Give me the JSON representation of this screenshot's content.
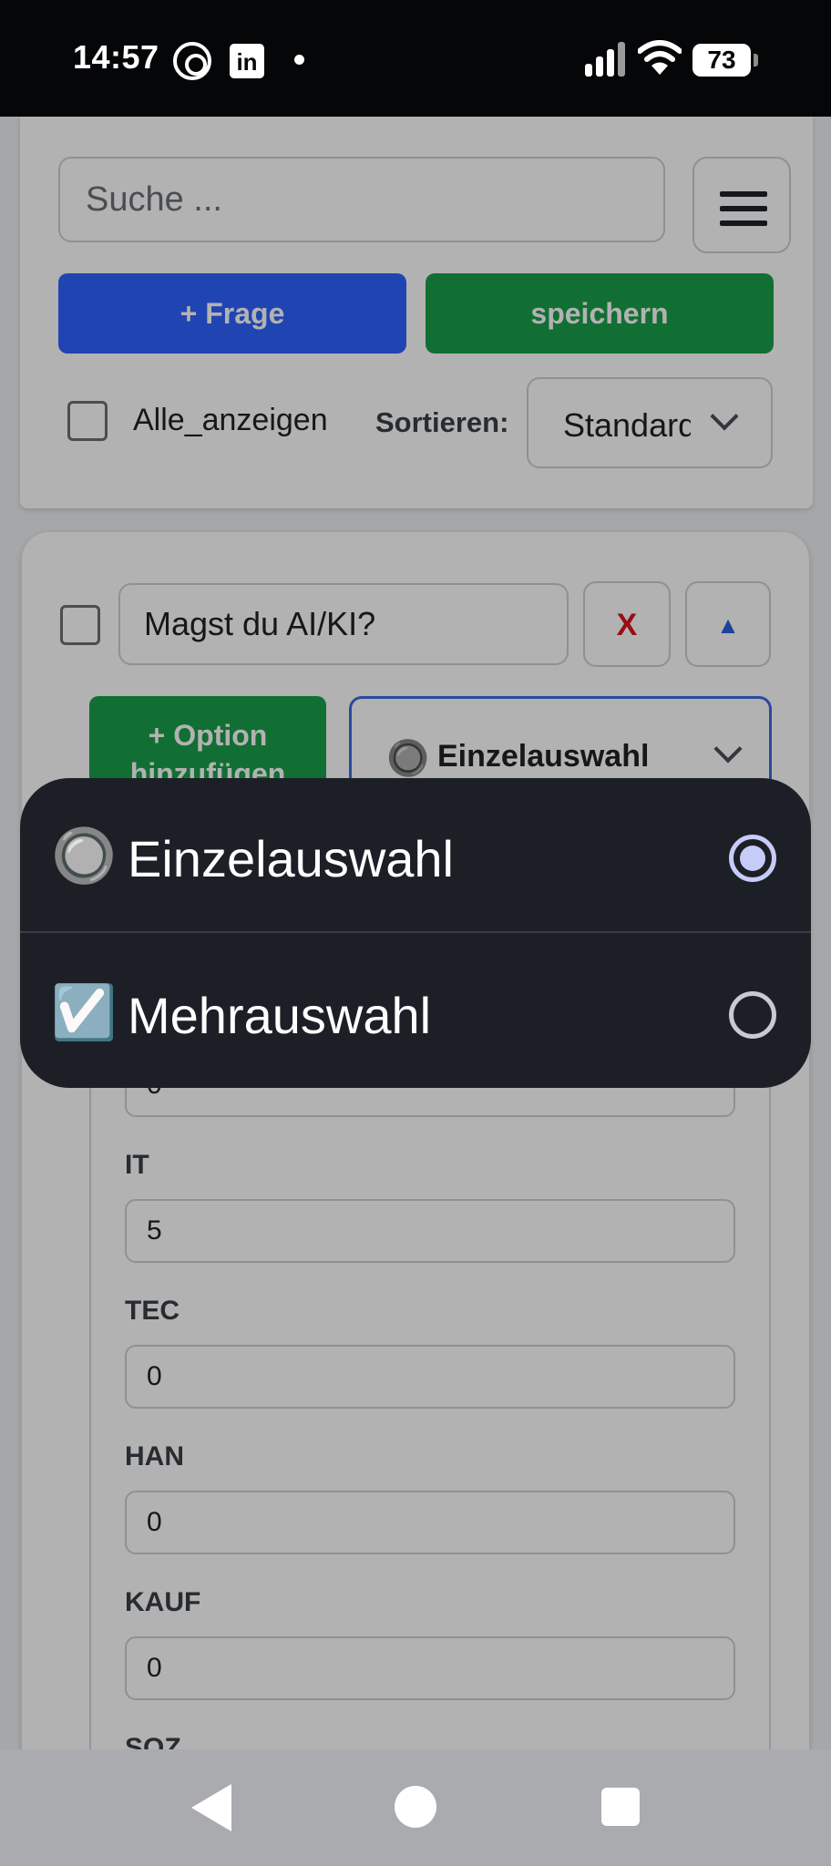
{
  "status_bar": {
    "time": "14:57",
    "icons": [
      "threads-icon",
      "linkedin-icon",
      "notification-dot",
      "signal-icon",
      "wifi-icon",
      "battery-icon"
    ],
    "linkedin_glyph": "in",
    "battery_level": "73"
  },
  "toolbar": {
    "search_placeholder": "Suche ...",
    "add_question_label": "+ Frage",
    "save_label": "speichern",
    "show_all_label": "Alle_anzeigen",
    "sort_label": "Sortieren:",
    "sort_value": "Standard"
  },
  "question": {
    "text": "Magst du AI/KI?",
    "delete_label": "X",
    "collapse_label": "▲",
    "add_option_label": "+ Option hinzufügen",
    "type_icon": "🔘",
    "type_value": "Einzelauswahl"
  },
  "options": [
    {
      "label": "IT",
      "value": "5"
    },
    {
      "label": "TEC",
      "value": "0"
    },
    {
      "label": "HAN",
      "value": "0"
    },
    {
      "label": "KAUF",
      "value": "0"
    },
    {
      "label": "SOZ",
      "value": ""
    }
  ],
  "dropdown": {
    "items": [
      {
        "icon": "🔘",
        "label": "Einzelauswahl",
        "selected": true
      },
      {
        "icon": "☑️",
        "label": "Mehrauswahl",
        "selected": false
      }
    ]
  },
  "colors": {
    "primary_blue": "#2f62ff",
    "save_green": "#19a04a",
    "delete_red": "#d8151d",
    "popup_bg": "#1d1f27"
  }
}
